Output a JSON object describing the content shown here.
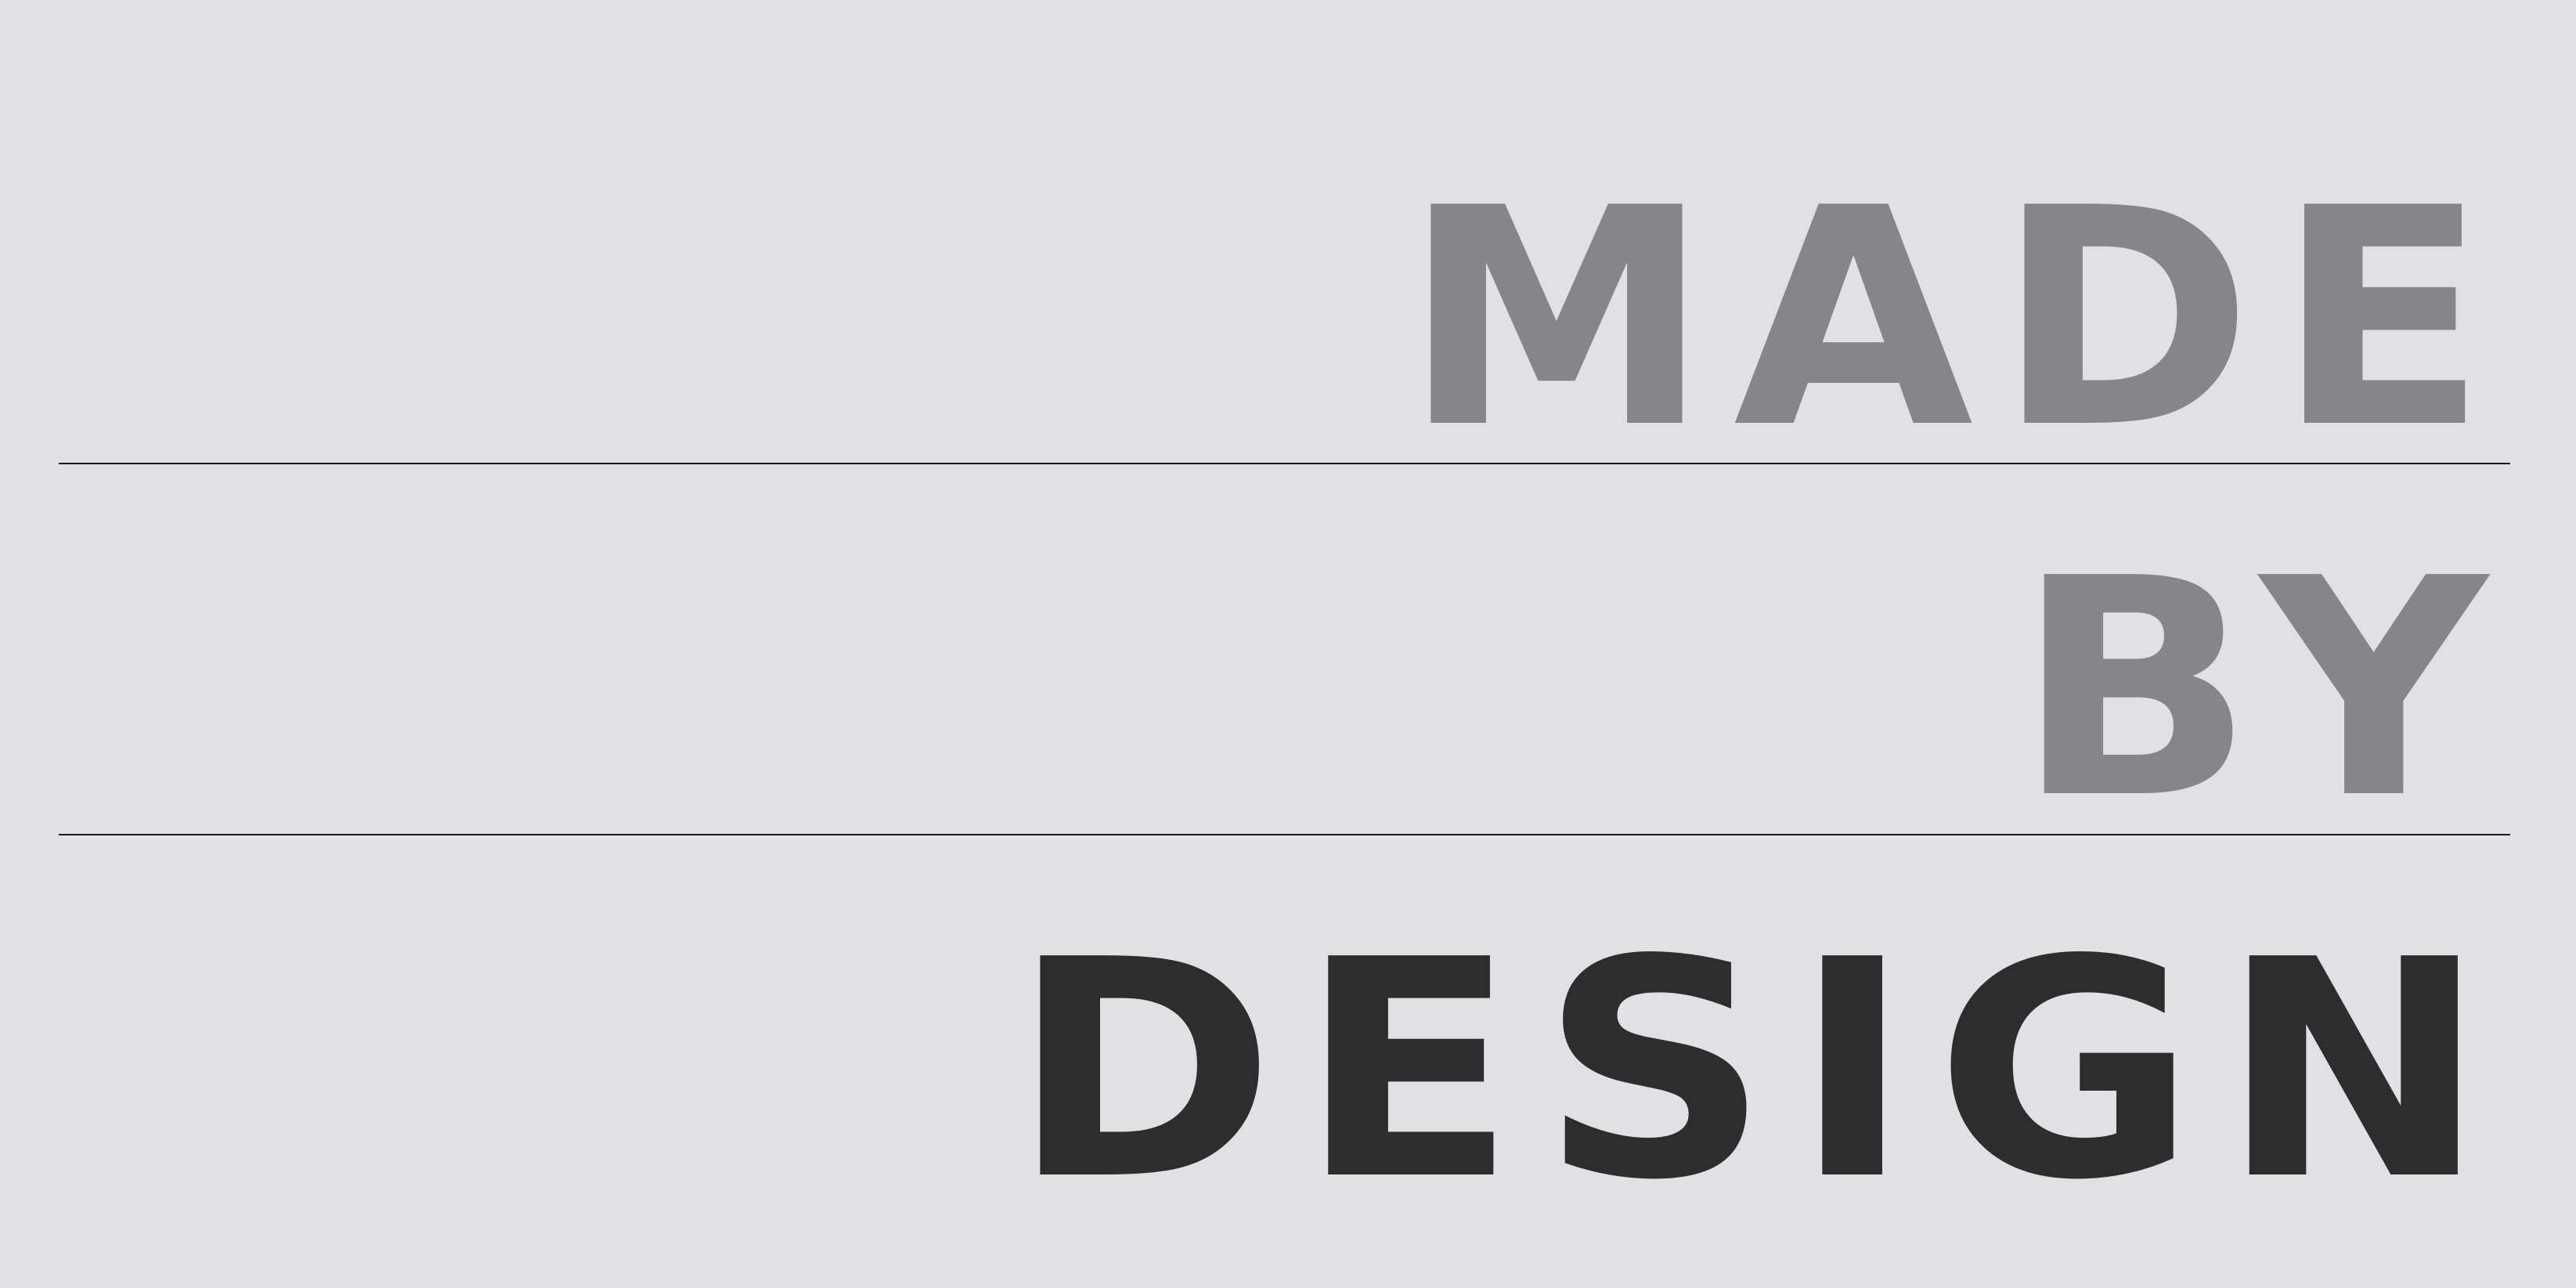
{
  "background_color": "#e1e0e4",
  "lines": [
    {
      "word": "MADE",
      "color": "#868688"
    },
    {
      "word": "BY",
      "color": "#868688"
    },
    {
      "word": "DESIGN",
      "color": "#2d2d2d"
    }
  ],
  "rule_color": "#1a1a1a"
}
